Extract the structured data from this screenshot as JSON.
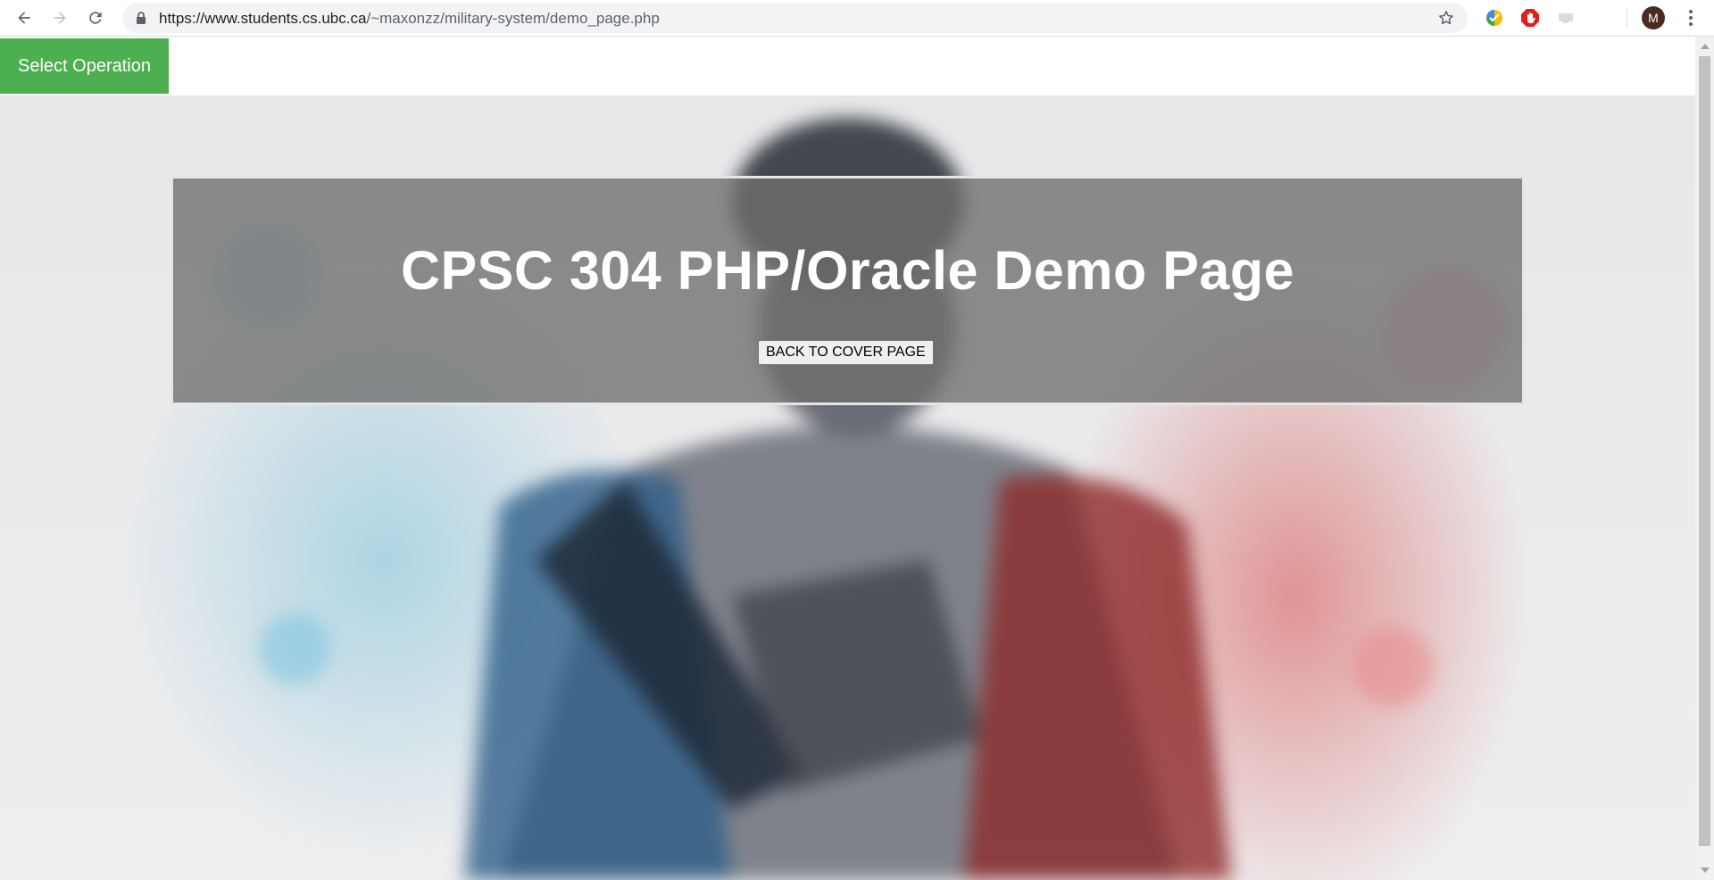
{
  "browser": {
    "url_host": "https://www.students.cs.ubc.ca",
    "url_path": "/~maxonzz/military-system/demo_page.php",
    "profile_initial": "M",
    "icons": [
      "back-arrow-icon",
      "forward-arrow-icon",
      "reload-icon",
      "lock-icon",
      "bookmark-star-icon",
      "extension-icon",
      "menu-kebab-icon"
    ]
  },
  "nav": {
    "select_operation_label": "Select Operation"
  },
  "hero": {
    "title": "CPSC 304 PHP/Oracle Demo Page",
    "back_button_label": "BACK TO COVER PAGE"
  },
  "colors": {
    "nav_green": "#4caf50",
    "panel_gray": "#6e6e6e",
    "tint_blue": "#3caad2",
    "tint_red": "#d22828"
  }
}
